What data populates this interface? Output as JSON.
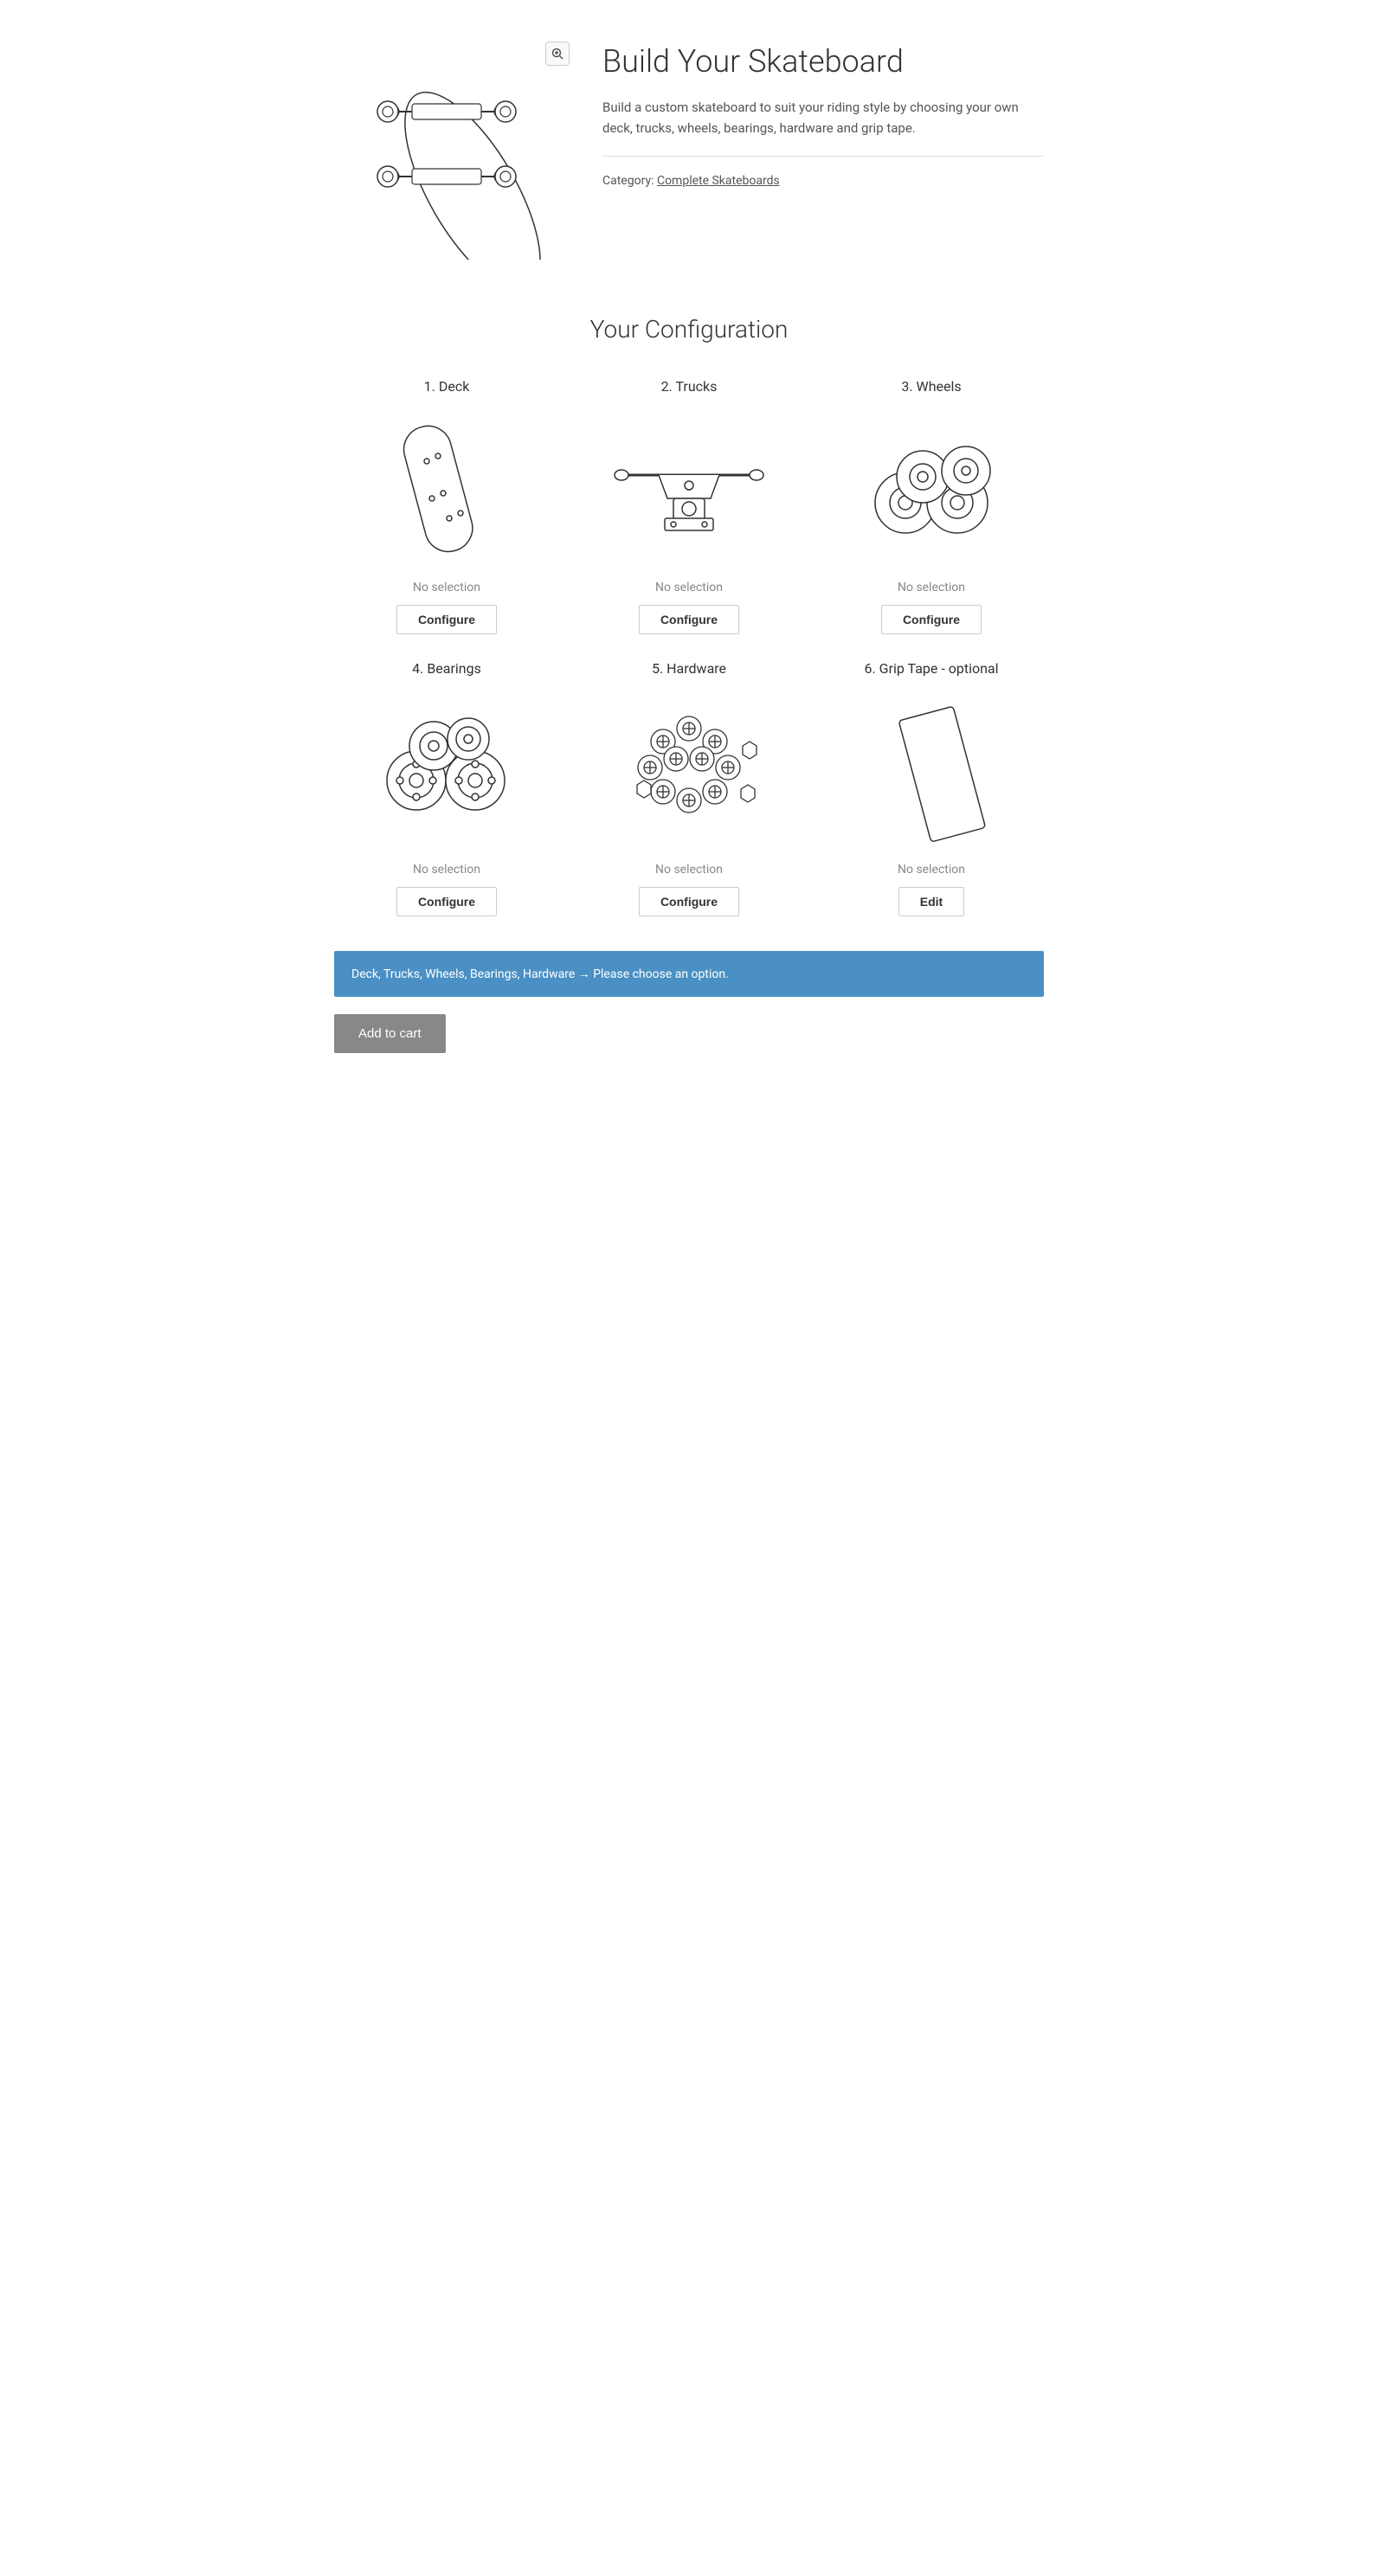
{
  "product": {
    "title": "Build Your Skateboard",
    "description": "Build a custom skateboard to suit your riding style by choosing your own deck, trucks, wheels, bearings, hardware and grip tape.",
    "category_label": "Category:",
    "category_link_text": "Complete Skateboards",
    "zoom_icon": "🔍"
  },
  "configuration": {
    "section_title": "Your Configuration",
    "items": [
      {
        "id": "deck",
        "number": "1",
        "label": "Deck",
        "status": "No selection",
        "button_label": "Configure",
        "button_type": "configure"
      },
      {
        "id": "trucks",
        "number": "2",
        "label": "Trucks",
        "status": "No selection",
        "button_label": "Configure",
        "button_type": "configure"
      },
      {
        "id": "wheels",
        "number": "3",
        "label": "Wheels",
        "status": "No selection",
        "button_label": "Configure",
        "button_type": "configure"
      },
      {
        "id": "bearings",
        "number": "4",
        "label": "Bearings",
        "status": "No selection",
        "button_label": "Configure",
        "button_type": "configure"
      },
      {
        "id": "hardware",
        "number": "5",
        "label": "Hardware",
        "status": "No selection",
        "button_label": "Configure",
        "button_type": "configure"
      },
      {
        "id": "grip-tape",
        "number": "6",
        "label": "Grip Tape - optional",
        "status": "No selection",
        "button_label": "Edit",
        "button_type": "edit"
      }
    ]
  },
  "alert": {
    "message": "Deck, Trucks, Wheels, Bearings, Hardware → Please choose an option."
  },
  "cart": {
    "button_label": "Add to cart"
  }
}
